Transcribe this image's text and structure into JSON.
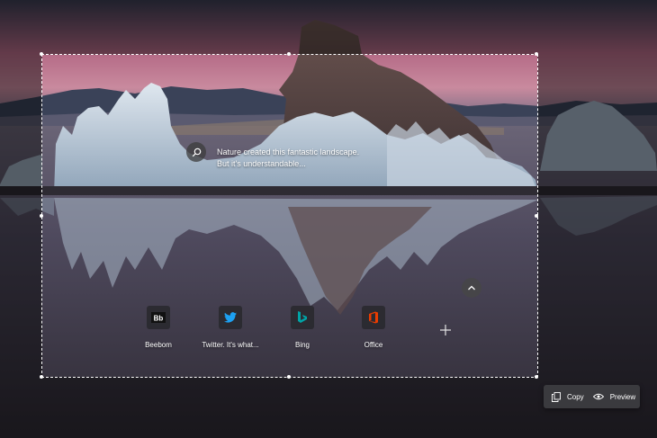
{
  "caption": {
    "line1": "Nature created this fantastic landscape.",
    "line2": "But it's understandable..."
  },
  "tiles": [
    {
      "label": "Beebom",
      "icon": "beebom-icon"
    },
    {
      "label": "Twitter. It's what...",
      "icon": "twitter-icon"
    },
    {
      "label": "Bing",
      "icon": "bing-icon"
    },
    {
      "label": "Office",
      "icon": "office-icon"
    }
  ],
  "toolbar": {
    "copy_label": "Copy",
    "preview_label": "Preview"
  },
  "icons": {
    "search": "search-icon",
    "chevron": "chevron-up-icon",
    "add": "plus-icon",
    "copy": "copy-icon",
    "preview": "eye-icon"
  },
  "colors": {
    "twitter": "#1da1f2",
    "bing": "#00a4a6",
    "office": "#eb3c00",
    "toolbar_bg": "#3a3a3e"
  }
}
